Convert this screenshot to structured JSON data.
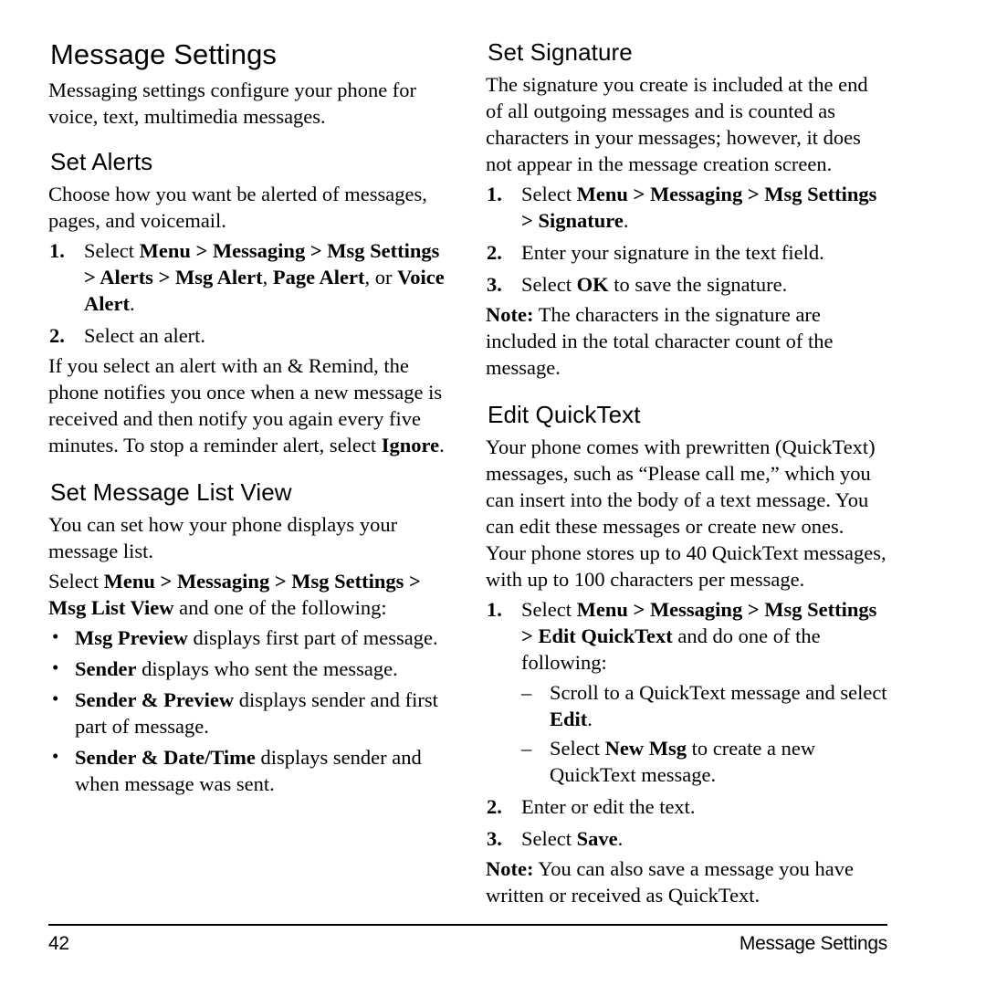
{
  "document": {
    "page_number": "42",
    "running_head": "Message Settings",
    "title": "Message Settings"
  },
  "left_column": {
    "intro": "Messaging settings configure your phone for voice, text, multimedia messages.",
    "set_alerts": {
      "heading": "Set Alerts",
      "intro": "Choose how you want be alerted of messages, pages, and voicemail.",
      "steps": [
        {
          "marker": "1.",
          "parts": [
            {
              "text": "Select ",
              "bold": false
            },
            {
              "text": "Menu",
              "bold": true
            },
            {
              "text": " > ",
              "bold": true
            },
            {
              "text": "Messaging",
              "bold": true
            },
            {
              "text": " > ",
              "bold": true
            },
            {
              "text": "Msg Settings",
              "bold": true
            },
            {
              "text": " > ",
              "bold": true
            },
            {
              "text": "Alerts",
              "bold": true
            },
            {
              "text": " > ",
              "bold": true
            },
            {
              "text": "Msg Alert",
              "bold": true
            },
            {
              "text": ", ",
              "bold": false
            },
            {
              "text": "Page Alert",
              "bold": true
            },
            {
              "text": ", or ",
              "bold": false
            },
            {
              "text": "Voice Alert",
              "bold": true
            },
            {
              "text": ".",
              "bold": false
            }
          ]
        },
        {
          "marker": "2.",
          "parts": [
            {
              "text": "Select an alert.",
              "bold": false
            }
          ]
        }
      ],
      "reminder_paragraph": [
        {
          "text": "If you select an alert with an & Remind, the phone notifies you once when a new message is received and then notify you again every five minutes. To stop a reminder alert, select ",
          "bold": false
        },
        {
          "text": "Ignore",
          "bold": true
        },
        {
          "text": ".",
          "bold": false
        }
      ]
    },
    "set_message_list_view": {
      "heading": "Set Message List View",
      "intro": "You can set how your phone displays your message list.",
      "select_path": [
        {
          "text": "Select ",
          "bold": false
        },
        {
          "text": "Menu",
          "bold": true
        },
        {
          "text": " > ",
          "bold": true
        },
        {
          "text": "Messaging",
          "bold": true
        },
        {
          "text": " > ",
          "bold": true
        },
        {
          "text": "Msg Settings",
          "bold": true
        },
        {
          "text": " > ",
          "bold": true
        },
        {
          "text": "Msg List View",
          "bold": true
        },
        {
          "text": " and one of the following:",
          "bold": false
        }
      ],
      "bullets": [
        [
          {
            "text": "Msg Preview",
            "bold": true
          },
          {
            "text": " displays first part of message.",
            "bold": false
          }
        ],
        [
          {
            "text": "Sender",
            "bold": true
          },
          {
            "text": " displays who sent the message.",
            "bold": false
          }
        ],
        [
          {
            "text": "Sender & Preview",
            "bold": true
          },
          {
            "text": " displays sender and first part of message.",
            "bold": false
          }
        ],
        [
          {
            "text": "Sender & Date/Time",
            "bold": true
          },
          {
            "text": " displays sender and when message was sent.",
            "bold": false
          }
        ]
      ]
    }
  },
  "right_column": {
    "set_signature": {
      "heading": "Set Signature",
      "intro": "The signature you create is included at the end of all outgoing messages and is counted as characters in your messages; however, it does not appear in the message creation screen.",
      "steps": [
        {
          "marker": "1.",
          "parts": [
            {
              "text": "Select ",
              "bold": false
            },
            {
              "text": "Menu",
              "bold": true
            },
            {
              "text": " > ",
              "bold": true
            },
            {
              "text": "Messaging",
              "bold": true
            },
            {
              "text": " > ",
              "bold": true
            },
            {
              "text": "Msg Settings",
              "bold": true
            },
            {
              "text": " > ",
              "bold": true
            },
            {
              "text": "Signature",
              "bold": true
            },
            {
              "text": ".",
              "bold": false
            }
          ]
        },
        {
          "marker": "2.",
          "parts": [
            {
              "text": "Enter your signature in the text field.",
              "bold": false
            }
          ]
        },
        {
          "marker": "3.",
          "parts": [
            {
              "text": "Select ",
              "bold": false
            },
            {
              "text": "OK",
              "bold": true
            },
            {
              "text": " to save the signature.",
              "bold": false
            }
          ]
        }
      ],
      "note": [
        {
          "text": "Note:",
          "bold": true
        },
        {
          "text": " The characters in the signature are included in the total character count of the message.",
          "bold": false
        }
      ]
    },
    "edit_quicktext": {
      "heading": "Edit QuickText",
      "intro": "Your phone comes with prewritten (QuickText) messages, such as “Please call me,” which you can insert into the body of a text message. You can edit these messages or create new ones. Your phone stores up to 40 QuickText messages, with up to 100 characters per message.",
      "step_one": {
        "marker": "1.",
        "parts": [
          {
            "text": "Select ",
            "bold": false
          },
          {
            "text": "Menu",
            "bold": true
          },
          {
            "text": " > ",
            "bold": true
          },
          {
            "text": "Messaging",
            "bold": true
          },
          {
            "text": " > ",
            "bold": true
          },
          {
            "text": "Msg Settings",
            "bold": true
          },
          {
            "text": " > ",
            "bold": true
          },
          {
            "text": "Edit QuickText",
            "bold": true
          },
          {
            "text": " and do one of the following:",
            "bold": false
          }
        ],
        "sub_items": [
          [
            {
              "text": "Scroll to a QuickText message and select ",
              "bold": false
            },
            {
              "text": "Edit",
              "bold": true
            },
            {
              "text": ".",
              "bold": false
            }
          ],
          [
            {
              "text": "Select ",
              "bold": false
            },
            {
              "text": "New Msg",
              "bold": true
            },
            {
              "text": " to create a new QuickText message.",
              "bold": false
            }
          ]
        ]
      },
      "steps_rest": [
        {
          "marker": "2.",
          "parts": [
            {
              "text": "Enter or edit the text.",
              "bold": false
            }
          ]
        },
        {
          "marker": "3.",
          "parts": [
            {
              "text": "Select ",
              "bold": false
            },
            {
              "text": "Save",
              "bold": true
            },
            {
              "text": ".",
              "bold": false
            }
          ]
        }
      ],
      "note": [
        {
          "text": "Note:",
          "bold": true
        },
        {
          "text": " You can also save a message you have written or received as QuickText.",
          "bold": false
        }
      ]
    }
  },
  "symbols": {
    "bullet": "•",
    "dash": "–"
  }
}
